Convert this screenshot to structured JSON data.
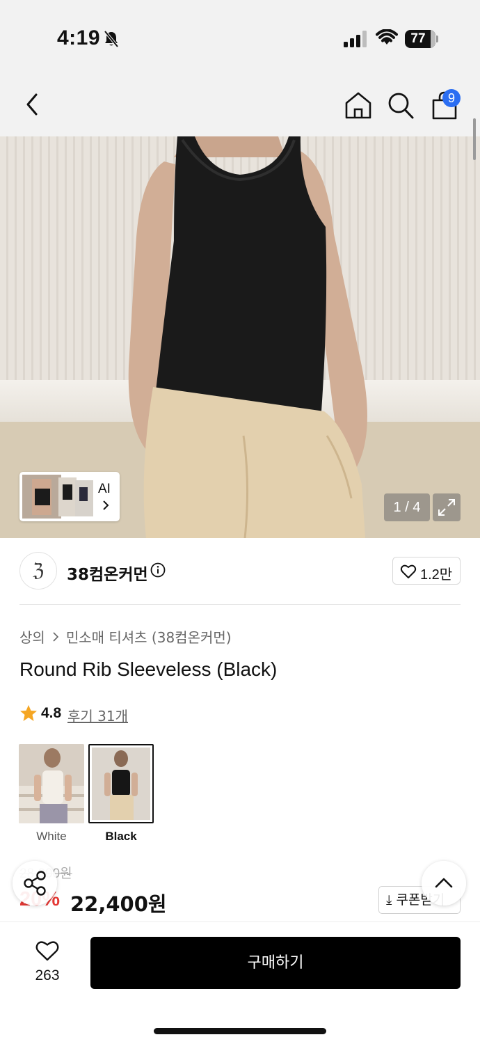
{
  "status_bar": {
    "time": "4:19",
    "battery": "77",
    "icons": [
      "bell-slash-icon",
      "signal-icon",
      "wifi-icon",
      "battery-icon"
    ]
  },
  "nav": {
    "icons": [
      "back-chevron-icon",
      "home-icon",
      "search-icon",
      "shopping-bag-icon"
    ],
    "cart_count": "9",
    "badge_color": "#2b6ef2"
  },
  "gallery": {
    "ai_label": "AI",
    "counter": "1 / 4",
    "icons": [
      "chevron-right-icon",
      "expand-icon"
    ]
  },
  "brand": {
    "name": "38컴온커먼",
    "logo_glyph": "ℨ",
    "like_count": "1.2만",
    "icons": [
      "info-icon",
      "heart-outline-icon"
    ]
  },
  "product": {
    "breadcrumb": [
      "상의",
      "민소매 티셔츠 (38컴온커먼)"
    ],
    "title": "Round Rib Sleeveless (Black)",
    "rating": "4.8",
    "review_link": "후기 31개",
    "star_color": "#f5a623",
    "colors": [
      {
        "label": "White",
        "selected": false
      },
      {
        "label": "Black",
        "selected": true
      }
    ],
    "original_price": "28,000원",
    "discount": "20%",
    "discount_color": "#e53935",
    "sale_price": "22,400원",
    "coupon_label": "⤓ 쿠폰받기"
  },
  "floating": {
    "icons": [
      "share-icon",
      "chevron-up-icon"
    ]
  },
  "bottom_bar": {
    "wishlist_count": "263",
    "buy_label": "구매하기"
  }
}
